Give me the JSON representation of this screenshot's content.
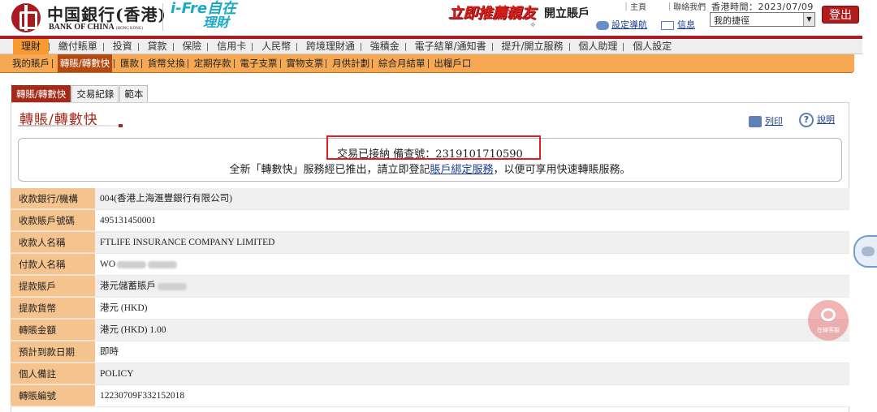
{
  "header": {
    "logo_cn": "中国銀行(香港)",
    "logo_en": "BANK OF CHINA",
    "logo_en_small": "(HONG KONG)",
    "ifre_line1": "i-Fre自在",
    "ifre_line2": "理財",
    "promo_red": "立即推薦親友",
    "promo_black": "開立賬戶",
    "top_link_home": "主頁",
    "top_link_contact": "聯絡我們",
    "guide_label": "設定導航",
    "message_label": "信息",
    "clock": "香港時間：2023/07/09",
    "quick_select": "我的捷徑",
    "logout_label": "登出"
  },
  "main_nav": [
    "理財",
    "繳付賬單",
    "投資",
    "貸款",
    "保險",
    "信用卡",
    "人民幣",
    "跨境理財通",
    "強積金",
    "電子結單/通知書",
    "提升/開立服務",
    "個人助理",
    "個人設定"
  ],
  "sub_nav": [
    "我的賬戶",
    "轉賬/轉數快",
    "匯款",
    "貨幣兌換",
    "定期存款",
    "電子支票",
    "實物支票",
    "月供計劃",
    "綜合月結單",
    "出糧戶口"
  ],
  "tabs": [
    "轉賬/轉數快",
    "交易紀錄",
    "範本"
  ],
  "page": {
    "title": "轉賬/轉數快",
    "print_label": "列印",
    "help_label": "說明",
    "accepted_text": "交易已接納 備查號：2319101710590",
    "promo_before": "全新「轉數快」服務經已推出，請立即登記",
    "promo_link": "賬戶綁定服務",
    "promo_after": "，以便可享用快速轉賬服務。"
  },
  "details": [
    {
      "label": "收款銀行/機構",
      "value": "004(香港上海滙豐銀行有限公司)"
    },
    {
      "label": "收款賬戶號碼",
      "value": "495131450001"
    },
    {
      "label": "收款人名稱",
      "value": "FTLIFE INSURANCE COMPANY LIMITED"
    },
    {
      "label": "付款人名稱",
      "value": "WO"
    },
    {
      "label": "提款賬戶",
      "value": "港元儲蓄賬戶"
    },
    {
      "label": "提款貨幣",
      "value": "港元 (HKD)"
    },
    {
      "label": "轉賬金額",
      "value": "港元 (HKD) 1.00"
    },
    {
      "label": "預計到款日期",
      "value": "即時"
    },
    {
      "label": "個人備註",
      "value": "POLICY"
    },
    {
      "label": "轉賬編號",
      "value": "12230709F332152018"
    }
  ],
  "cs_label": "在線客服"
}
